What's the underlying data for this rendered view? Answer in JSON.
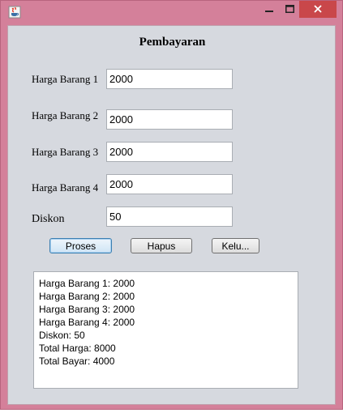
{
  "window": {
    "icons": {
      "app": "java-cup-icon",
      "minimize": "minimize-icon",
      "maximize": "maximize-icon",
      "close": "close-icon"
    },
    "colors": {
      "frame": "#d4809a",
      "client": "#d6d9df",
      "close": "#c9474a"
    }
  },
  "form": {
    "title": "Pembayaran",
    "fields": [
      {
        "label": "Harga Barang 1",
        "value": "2000"
      },
      {
        "label": "Harga Barang 2",
        "value": "2000"
      },
      {
        "label": "Harga Barang 3",
        "value": "2000"
      },
      {
        "label": "Harga Barang 4",
        "value": "2000"
      },
      {
        "label": "Diskon",
        "value": "50"
      }
    ],
    "buttons": {
      "proses": "Proses",
      "hapus": "Hapus",
      "keluar": "Kelu..."
    }
  },
  "output": {
    "lines": [
      "Harga Barang 1: 2000",
      "Harga Barang 2: 2000",
      "Harga Barang 3: 2000",
      "Harga Barang 4: 2000",
      "Diskon: 50",
      "Total Harga: 8000",
      "Total Bayar: 4000"
    ]
  }
}
